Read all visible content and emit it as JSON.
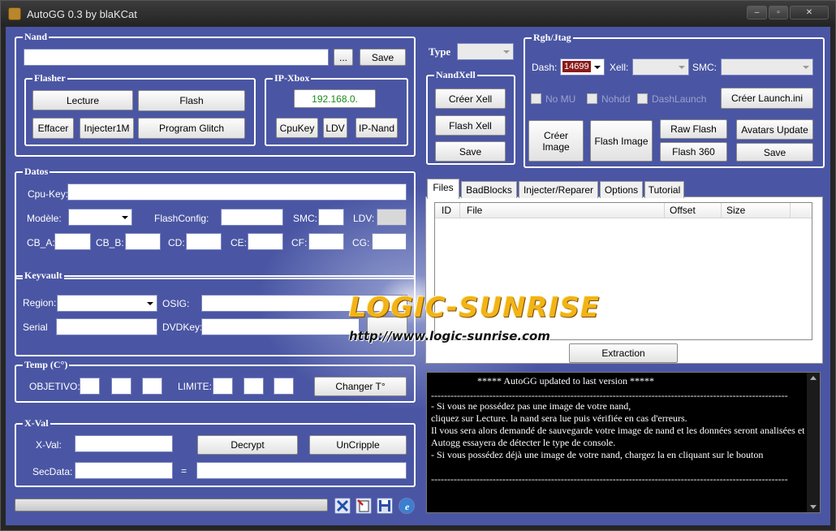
{
  "window": {
    "title": "AutoGG 0.3 by blaKCat",
    "minimize": "–",
    "maximize": "▫",
    "close": "✕"
  },
  "nand": {
    "legend": "Nand",
    "path_value": "",
    "browse_label": "...",
    "save_label": "Save"
  },
  "flasher": {
    "legend": "Flasher",
    "lecture": "Lecture",
    "flash": "Flash",
    "effacer": "Effacer",
    "injecter1m": "Injecter1M",
    "program_glitch": "Program Glitch"
  },
  "ipxbox": {
    "legend": "IP-Xbox",
    "ip_value": "192.168.0.",
    "cpukey": "CpuKey",
    "ldv": "LDV",
    "ipnand": "IP-Nand"
  },
  "type": {
    "label": "Type",
    "value": ""
  },
  "nandxell": {
    "legend": "NandXell",
    "creer_xell": "Créer Xell",
    "flash_xell": "Flash Xell",
    "save": "Save"
  },
  "rgh": {
    "legend": "Rgh/Jtag",
    "dash_label": "Dash:",
    "dash_value": "14699",
    "xell_label": "Xell:",
    "smc_label": "SMC:",
    "nomu": "No MU",
    "nohdd": "Nohdd",
    "dashlaunch": "DashLaunch",
    "creer_launch": "Créer Launch.ini",
    "creer_image": "Créer Image",
    "flash_image": "Flash Image",
    "raw_flash": "Raw Flash",
    "flash360": "Flash 360",
    "avatars_update": "Avatars Update",
    "save": "Save"
  },
  "datos": {
    "legend": "Datos",
    "cpukey_label": "Cpu-Key:",
    "modele_label": "Modèle:",
    "flashconfig_label": "FlashConfig:",
    "smc_label": "SMC:",
    "ldv_label": "LDV:",
    "cba_label": "CB_A:",
    "cbb_label": "CB_B:",
    "cd_label": "CD:",
    "ce_label": "CE:",
    "cf_label": "CF:",
    "cg_label": "CG:"
  },
  "keyvault": {
    "legend": "Keyvault",
    "region_label": "Region:",
    "osig_label": "OSIG:",
    "serial_label": "Serial",
    "dvdkey_label": "DVDKey:"
  },
  "temp": {
    "legend": "Temp (C°)",
    "objetivo_label": "OBJETIVO:",
    "limite_label": "LIMITE:",
    "changer": "Changer T°"
  },
  "xval": {
    "legend": "X-Val",
    "xval_label": "X-Val:",
    "secdata_label": "SecData:",
    "equals": "=",
    "decrypt": "Decrypt",
    "uncripple": "UnCripple"
  },
  "tabs": [
    "Files",
    "BadBlocks",
    "Injecter/Reparer",
    "Options",
    "Tutorial"
  ],
  "files": {
    "columns": [
      "ID",
      "File",
      "Offset",
      "Size"
    ],
    "rows": [],
    "extraction": "Extraction"
  },
  "watermark": {
    "title": "LOGIC-SUNRISE",
    "url": "http://www.logic-sunrise.com"
  },
  "console": {
    "header": "*****                    AutoGG updated to last version                    *****",
    "separator": "--------------------------------------------------------------------------------------------------------------------------------",
    "lines": [
      "- Si vous ne possédez pas une image de votre nand,",
      "cliquez sur Lecture. la nand sera lue puis vérifiée en cas d'erreurs.",
      "Il vous sera alors demandé de sauvegarde votre image de nand et les données seront analisées et",
      "Autogg essayera de détecter le type de console.",
      "- Si vous possédez déjà une image de votre nand, chargez la en cliquant sur le bouton"
    ]
  },
  "status": {
    "progress": 0
  },
  "icons": [
    "tools-icon",
    "erase-icon",
    "disk-icon",
    "info-icon"
  ],
  "colors": {
    "background": "#4a56a3",
    "ip_text": "#1a8a1a",
    "watermark": "#f2b316"
  }
}
